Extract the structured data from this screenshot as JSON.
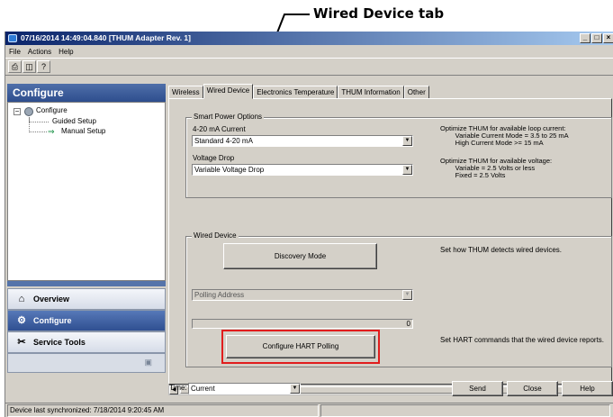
{
  "callout": {
    "text": "Wired Device tab"
  },
  "window": {
    "title": "07/16/2014 14:49:04.840 [THUM Adapter Rev. 1]",
    "buttons": [
      "_",
      "□",
      "×"
    ]
  },
  "menu": {
    "items": [
      "File",
      "Actions",
      "Help"
    ]
  },
  "toolbar": {
    "icons": [
      "printer-icon",
      "print-preview-icon",
      "help-pointer-icon"
    ]
  },
  "sidebar": {
    "header": "Configure",
    "tree": {
      "root": "Configure",
      "children": [
        "Guided Setup",
        "Manual Setup"
      ]
    },
    "nav": [
      {
        "label": "Overview",
        "icon": "home-icon",
        "active": false
      },
      {
        "label": "Configure",
        "icon": "configure-icon",
        "active": true
      },
      {
        "label": "Service Tools",
        "icon": "tools-icon",
        "active": false
      }
    ]
  },
  "tabs": [
    "Wireless",
    "Wired Device",
    "Electronics Temperature",
    "THUM Information",
    "Other"
  ],
  "active_tab": "Wired Device",
  "smart_power": {
    "title": "Smart Power Options",
    "current_label": "4-20 mA Current",
    "current_value": "Standard 4-20 mA",
    "current_help": "Optimize THUM for available loop current:\n        Variable Current Mode = 3.5 to 25 mA\n        High Current Mode >= 15 mA",
    "voltage_label": "Voltage Drop",
    "voltage_value": "Variable Voltage Drop",
    "voltage_help": "Optimize THUM for available voltage:\n        Variable = 2.5 Volts or less\n        Fixed = 2.5 Volts"
  },
  "wired_device": {
    "title": "Wired Device",
    "discovery_button": "Discovery Mode",
    "discovery_help": "Set how THUM detects wired devices.",
    "polling_value": "Polling Address",
    "progress_text": "0",
    "progress_fraction": 0,
    "hart_button": "Configure HART Polling",
    "hart_help": "Set HART commands that the wired device reports."
  },
  "bottom": {
    "time_label": "Time:",
    "time_value": "Current",
    "send": "Send",
    "close": "Close",
    "help": "Help"
  },
  "status": {
    "text": "Device last synchronized: 7/18/2014 9:20:45 AM"
  },
  "colors": {
    "highlight": "#e11d1d",
    "title_bar": "#0a246a",
    "nav_active": "#2f4f91"
  }
}
